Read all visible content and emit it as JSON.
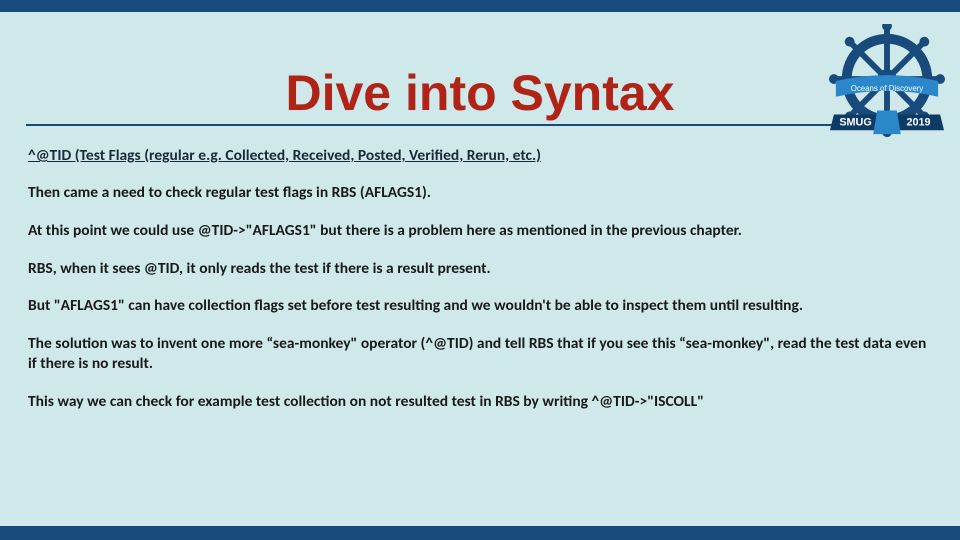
{
  "header": {
    "title": "Dive into Syntax"
  },
  "logo": {
    "name": "ship-wheel-logo",
    "banner_top_text": "Oceans of Discovery",
    "banner_bottom_left": "SMUG",
    "banner_bottom_right": "2019"
  },
  "subheading": "^@TID (Test Flags (regular e.g. Collected, Received, Posted, Verified, Rerun, etc.)",
  "paragraphs": [
    "Then came a need to check regular test flags in RBS (AFLAGS1).",
    "At this point we could use @TID->\"AFLAGS1\" but there is a problem here as mentioned in the previous chapter.",
    "RBS, when it sees @TID, it only reads the test if there is a result present.",
    "But \"AFLAGS1\" can have collection flags set before test resulting and we wouldn't be able to inspect them until resulting.",
    "The solution was to invent one more “sea-monkey\" operator (^@TID) and tell RBS that if you see this “sea-monkey\", read the test data even if there is no result.",
    "This way we can check for example test collection on not resulted test in RBS by writing ^@TID->\"ISCOLL\""
  ],
  "colors": {
    "background": "#cfe8e9",
    "bar": "#184a7c",
    "title": "#b02418"
  }
}
